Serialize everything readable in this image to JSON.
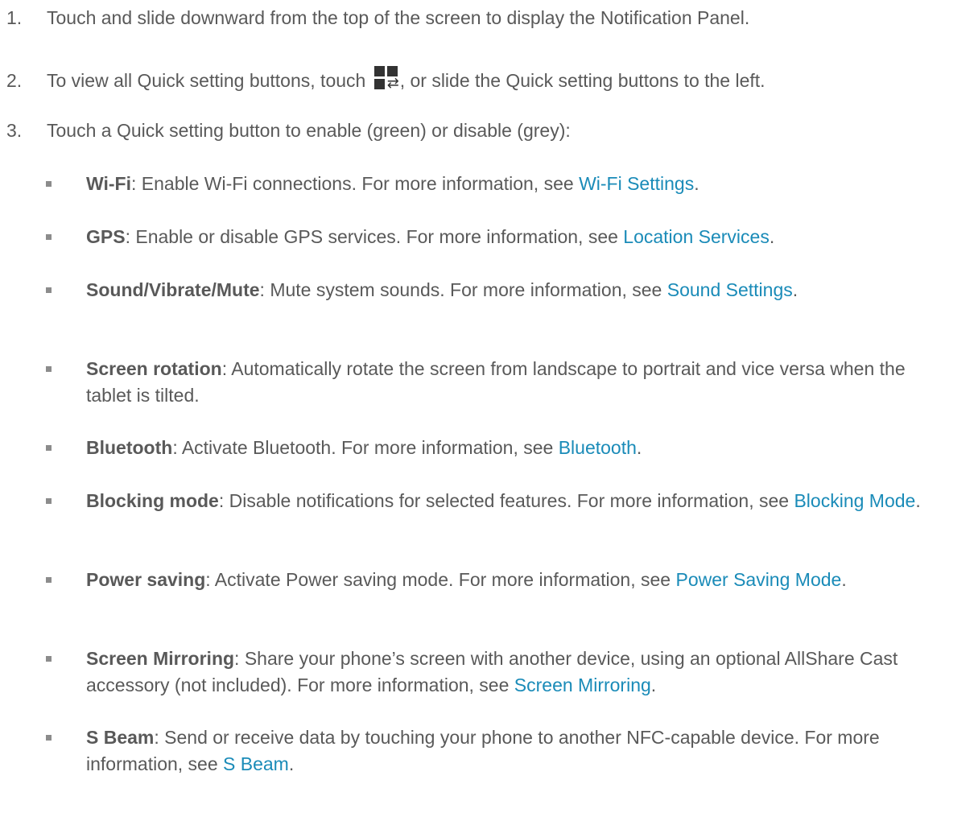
{
  "steps": [
    {
      "num": "1.",
      "text": "Touch and slide downward from the top of the screen to display the Notification Panel."
    },
    {
      "num": "2.",
      "text_before": "To view all Quick setting buttons, touch ",
      "text_after": ", or slide the Quick setting buttons to the left."
    },
    {
      "num": "3.",
      "text": "Touch a Quick setting button to enable (green) or disable (grey):"
    }
  ],
  "qs_icon": "quick-settings-grid-swap-icon",
  "link_color": "#1a8bb8",
  "items": [
    {
      "term": "Wi-Fi",
      "desc": ": Enable Wi-Fi connections. For more information, see ",
      "link": "Wi-Fi Settings",
      "end": "."
    },
    {
      "term": "GPS",
      "desc": ": Enable or disable GPS services. For more information, see ",
      "link": "Location Services",
      "end": "."
    },
    {
      "term": "Sound/Vibrate/Mute",
      "desc": ": Mute system sounds. For more information, see ",
      "link": "Sound Settings",
      "end": "."
    },
    {
      "term": "Screen rotation",
      "desc": ": Automatically rotate the screen from landscape to portrait and vice versa when the tablet is tilted."
    },
    {
      "term": "Bluetooth",
      "desc": ": Activate Bluetooth. For more information, see ",
      "link": "Bluetooth",
      "end": "."
    },
    {
      "term": "Blocking mode",
      "desc": ": Disable notifications for selected features. For more information, see ",
      "link": "Blocking Mode",
      "end": "."
    },
    {
      "term": "Power saving",
      "desc": ": Activate Power saving mode. For more information, see ",
      "link": "Power Saving Mode",
      "end": "."
    },
    {
      "term": "Screen Mirroring",
      "desc": ": Share your phone’s screen with another device, using an optional AllShare Cast accessory (not included). For more information, see ",
      "link": "Screen Mirroring",
      "end": "."
    },
    {
      "term": "S Beam",
      "desc": ": Send or receive data by touching your phone to another NFC-capable device. For more information, see ",
      "link": "S Beam",
      "end": "."
    }
  ]
}
